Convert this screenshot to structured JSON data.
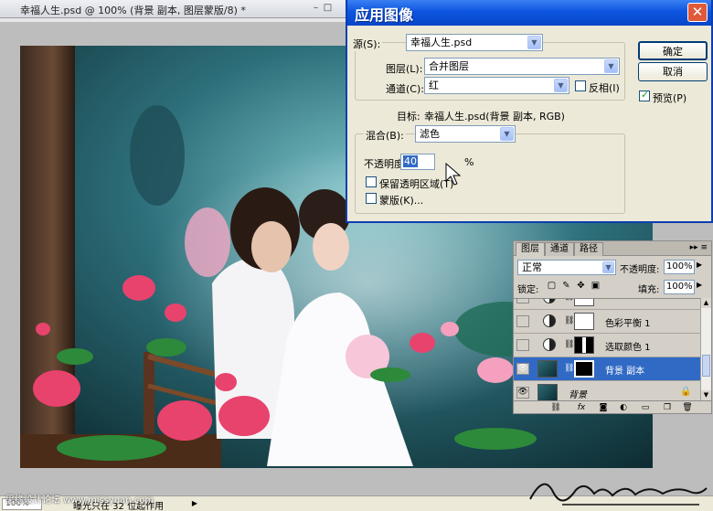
{
  "document": {
    "title": "幸福人生.psd @ 100% (背景 副本, 图层蒙版/8) *",
    "zoom": "100%",
    "status": "曝光只在 32 位起作用",
    "watermark": "思缘设计论坛 www.missyuan.com",
    "signature": "Huosharrizuo"
  },
  "dialog": {
    "title": "应用图像",
    "close": "✕",
    "source_label": "源(S):",
    "source_value": "幸福人生.psd",
    "layer_label": "图层(L):",
    "layer_value": "合并图层",
    "channel_label": "通道(C):",
    "channel_value": "红",
    "invert_label": "反相(I)",
    "invert_checked": false,
    "target_label": "目标:",
    "target_value": "幸福人生.psd(背景 副本, RGB)",
    "blend_label": "混合(B):",
    "blend_value": "滤色",
    "opacity_label": "不透明度(O):",
    "opacity_value": "40",
    "opacity_unit": "%",
    "preserve_label": "保留透明区域(T)",
    "preserve_checked": false,
    "mask_label": "蒙版(K)...",
    "mask_checked": false,
    "ok_button": "确定",
    "cancel_button": "取消",
    "preview_label": "预览(P)",
    "preview_checked": true
  },
  "layers_panel": {
    "tabs": [
      "图层",
      "通道",
      "路径"
    ],
    "active_tab": "图层",
    "menu": "▸▸ ≡",
    "blend_mode": "正常",
    "opacity_label": "不透明度:",
    "opacity_value": "100%",
    "lock_label": "锁定:",
    "fill_label": "填充:",
    "fill_value": "100%",
    "layers": [
      {
        "name": "",
        "visible": false,
        "type": "adjustment",
        "selected": false
      },
      {
        "name": "色彩平衡 1",
        "visible": false,
        "type": "adjustment",
        "selected": false
      },
      {
        "name": "选取颜色 1",
        "visible": false,
        "type": "adjustment",
        "selected": false
      },
      {
        "name": "背景 副本",
        "visible": true,
        "type": "image-mask",
        "selected": true
      },
      {
        "name": "背景",
        "visible": true,
        "type": "image",
        "selected": false
      }
    ]
  }
}
